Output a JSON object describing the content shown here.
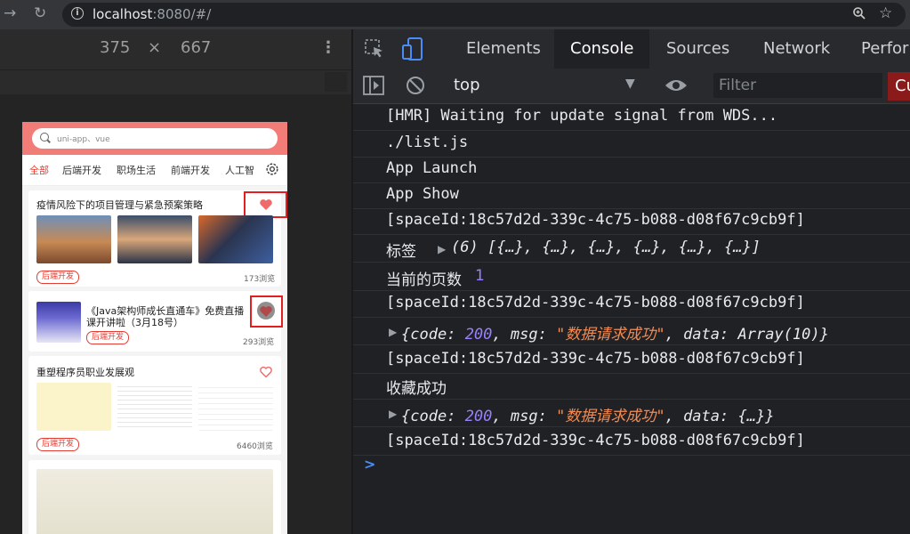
{
  "browser": {
    "url_host": "localhost",
    "url_rest": ":8080/#/"
  },
  "device": {
    "width": "375",
    "times": "×",
    "height": "667",
    "more": "⋮"
  },
  "phone": {
    "search_placeholder": "uni-app、vue",
    "tabs": [
      "全部",
      "后端开发",
      "职场生活",
      "前端开发",
      "人工智"
    ],
    "cards": [
      {
        "title": "疫情风险下的项目管理与紧急预案策略",
        "badge": "后端开发",
        "views": "173浏览"
      },
      {
        "title": "《Java架构师成长直通车》免费直播课开讲啦（3月18号）",
        "title_line1": "《Java架构师成长直通车》免费直播",
        "title_line2": "课开讲啦（3月18号）",
        "badge": "后端开发",
        "views": "293浏览"
      },
      {
        "title": "重塑程序员职业发展观",
        "badge": "后端开发",
        "views": "6460浏览"
      }
    ]
  },
  "devtools": {
    "tabs": [
      "Elements",
      "Console",
      "Sources",
      "Network",
      "Perfor"
    ],
    "active_tab": "Console",
    "context": "top",
    "filter_placeholder": "Filter",
    "red_button": "Cu",
    "lines": [
      "[HMR] Waiting for update signal from WDS...",
      "./list.js",
      "App Launch",
      "App Show",
      "[spaceId:18c57d2d-339c-4c75-b088-d08f67c9cb9f]",
      "标签",
      "当前的页数",
      "[spaceId:18c57d2d-339c-4c75-b088-d08f67c9cb9f]",
      "[spaceId:18c57d2d-339c-4c75-b088-d08f67c9cb9f]",
      "收藏成功",
      "[spaceId:18c57d2d-339c-4c75-b088-d08f67c9cb9f]"
    ],
    "tag_count": "(6)",
    "tag_items": "[{…}, {…}, {…}, {…}, {…}, {…}]",
    "page_num": "1",
    "obj1": {
      "k1": "code",
      "v1": "200",
      "k2": "msg",
      "v2": "\"数据请求成功\"",
      "k3": "data",
      "v3": "Array(10)}"
    },
    "obj2": {
      "k1": "code",
      "v1": "200",
      "k2": "msg",
      "v2": "\"数据请求成功\"",
      "k3": "data",
      "v3": "{…}}"
    }
  }
}
